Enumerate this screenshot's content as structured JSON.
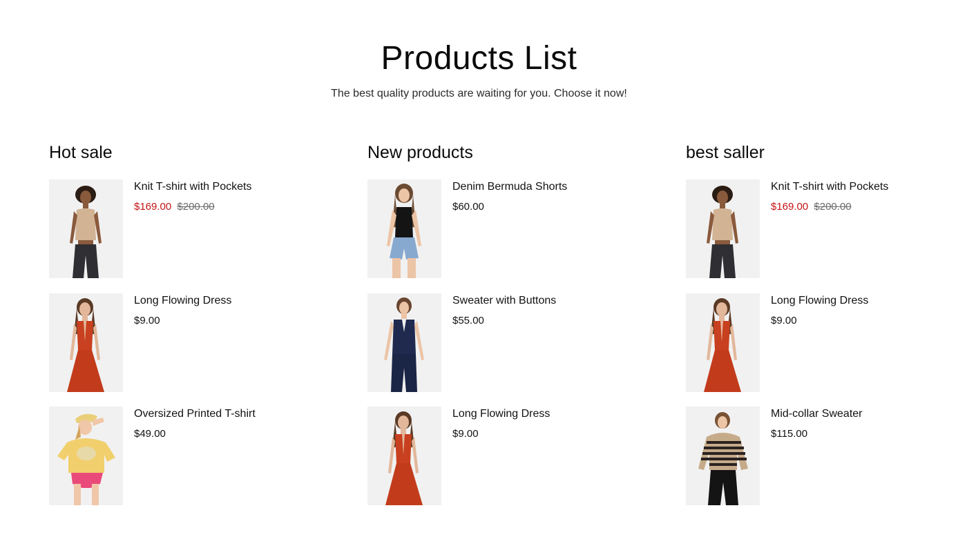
{
  "header": {
    "title": "Products List",
    "subtitle": "The best quality products are waiting for you. Choose it now!"
  },
  "colors": {
    "sale_price": "#c51414",
    "thumb_background": "#f1f1f1"
  },
  "columns": [
    {
      "title": "Hot sale",
      "products": [
        {
          "name": "Knit T-shirt with Pockets",
          "price": "$169.00",
          "old_price": "$200.00",
          "image": "woman-tan-knit-halter-top-dark-jeans"
        },
        {
          "name": "Long Flowing Dress",
          "price": "$9.00",
          "old_price": "",
          "image": "woman-rust-red-halter-dress"
        },
        {
          "name": "Oversized Printed T-shirt",
          "price": "$49.00",
          "old_price": "",
          "image": "woman-yellow-tshirt-pink-bottoms-visor"
        }
      ]
    },
    {
      "title": "New products",
      "products": [
        {
          "name": "Denim Bermuda Shorts",
          "price": "$60.00",
          "old_price": "",
          "image": "woman-black-tank-denim-shorts"
        },
        {
          "name": "Sweater with Buttons",
          "price": "$55.00",
          "old_price": "",
          "image": "woman-navy-button-vest-set"
        },
        {
          "name": "Long Flowing Dress",
          "price": "$9.00",
          "old_price": "",
          "image": "woman-rust-red-halter-dress"
        }
      ]
    },
    {
      "title": "best saller",
      "products": [
        {
          "name": "Knit T-shirt with Pockets",
          "price": "$169.00",
          "old_price": "$200.00",
          "image": "woman-tan-knit-halter-top-dark-jeans"
        },
        {
          "name": "Long Flowing Dress",
          "price": "$9.00",
          "old_price": "",
          "image": "woman-rust-red-halter-dress"
        },
        {
          "name": "Mid-collar Sweater",
          "price": "$115.00",
          "old_price": "",
          "image": "woman-striped-sweater-leather-pants"
        }
      ]
    }
  ]
}
